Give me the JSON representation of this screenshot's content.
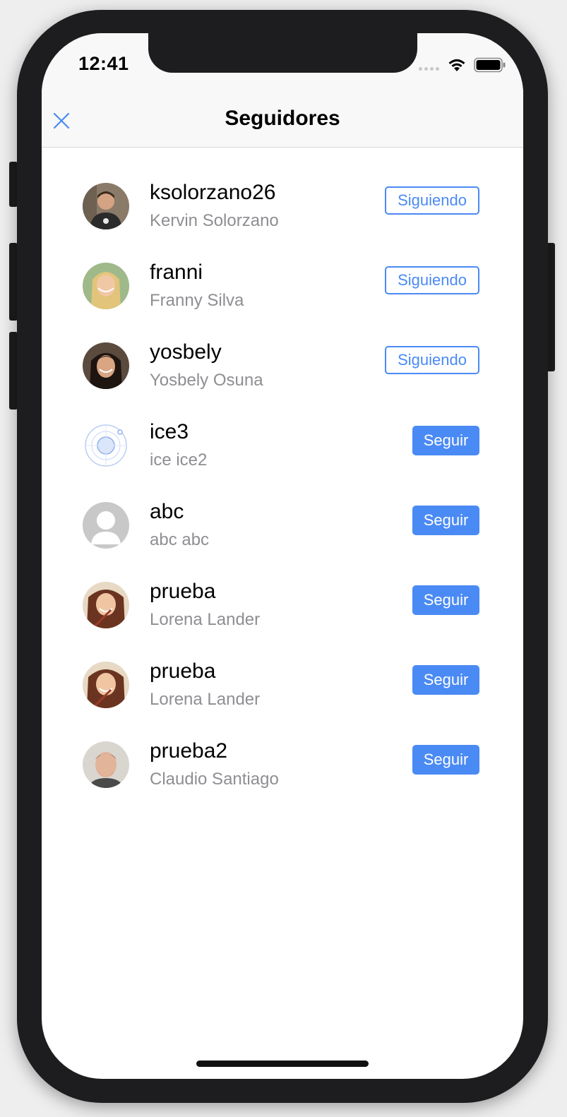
{
  "status_bar": {
    "time": "12:41"
  },
  "nav": {
    "title": "Seguidores"
  },
  "followers": [
    {
      "username": "ksolorzano26",
      "full_name": "Kervin Solorzano",
      "button": "Siguiendo",
      "following": true,
      "avatar": "photo-man-dark-hair"
    },
    {
      "username": "franni",
      "full_name": "Franny Silva",
      "button": "Siguiendo",
      "following": true,
      "avatar": "photo-woman-blonde"
    },
    {
      "username": "yosbely",
      "full_name": "Yosbely Osuna",
      "button": "Siguiendo",
      "following": true,
      "avatar": "photo-woman-dark-hair"
    },
    {
      "username": "ice3",
      "full_name": "ice ice2",
      "button": "Seguir",
      "following": false,
      "avatar": "ionic-logo"
    },
    {
      "username": "abc",
      "full_name": "abc abc",
      "button": "Seguir",
      "following": false,
      "avatar": "default-placeholder"
    },
    {
      "username": "prueba",
      "full_name": "Lorena Lander",
      "button": "Seguir",
      "following": false,
      "avatar": "photo-woman-auburn"
    },
    {
      "username": "prueba",
      "full_name": "Lorena Lander",
      "button": "Seguir",
      "following": false,
      "avatar": "photo-woman-auburn"
    },
    {
      "username": "prueba2",
      "full_name": "Claudio Santiago",
      "button": "Seguir",
      "following": false,
      "avatar": "photo-man-beard"
    }
  ],
  "colors": {
    "accent": "#4a8af4",
    "secondary_text": "#8e8e93",
    "nav_bg": "#f8f8f8"
  }
}
